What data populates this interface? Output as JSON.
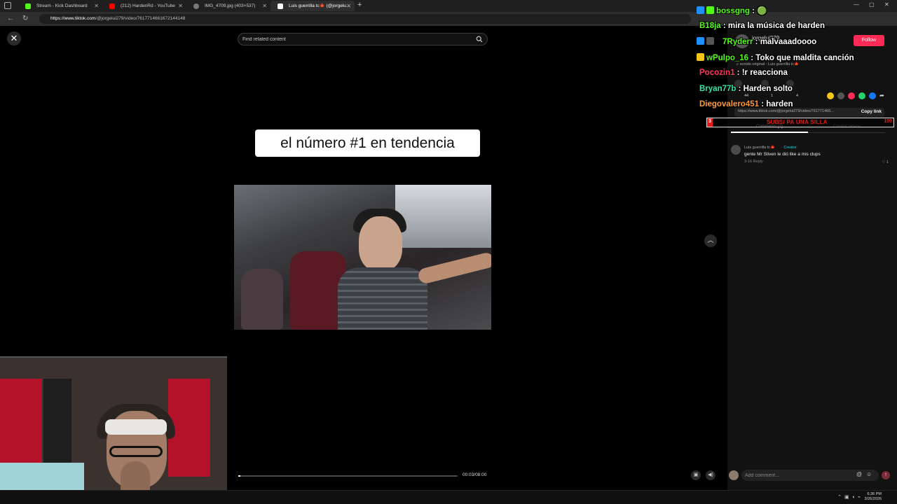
{
  "browser": {
    "tabs": [
      {
        "label": "Stream - Kick Dashboard",
        "color": "#53fc18",
        "active": false
      },
      {
        "label": "(212) HardenRd - YouTube",
        "color": "#ff0000",
        "active": false
      },
      {
        "label": "IMG_4709.jpg (403×537)",
        "color": "#888888",
        "active": false
      },
      {
        "label": "Luis guerrilla tc🍁 (@jorgelu...",
        "color": "#ffffff",
        "active": true
      }
    ],
    "url_host": "https://www.tiktok.com",
    "url_path": "/@jorgelui279/video/7617714661672144148"
  },
  "tiktok": {
    "close_icon": "close-icon",
    "search_placeholder": "Find related content",
    "caption": "el número #1 en tendencia",
    "time": "00:03/08:00",
    "progress": 0.01,
    "username": "jorgelui279",
    "follow_label": "Follow",
    "sound": "♫ sonido original - Luis guerrilla tc🍁",
    "stats": {
      "likes": "44",
      "comments": "1",
      "saves": "4"
    },
    "share_link": "https://www.tiktok.com/@jorgelui279/video/761771466...",
    "copy_link_label": "Copy link",
    "tab_comments": "Comments (1)",
    "tab_creator": "Creator videos",
    "comment": {
      "author": "Luis guerrilla tc🍁",
      "creator_tag": "· Creator",
      "text": "gente Mr Stiven le dió like a mis clups",
      "meta": "3-16    Reply",
      "likes": "♡ 1"
    },
    "comment_placeholder": "Add comment..."
  },
  "goal": {
    "count": "3",
    "label": "SUBS/ PA UNA SILLA",
    "target": "100",
    "progress": 0.03
  },
  "chat": [
    {
      "user": "bossgng",
      "user_color": "#53fc18",
      "msg": " : 🟢",
      "badge": "#1e90ff"
    },
    {
      "user": "B18ja",
      "user_color": "#53fc18",
      "msg": " : mira la música de harden",
      "badge": ""
    },
    {
      "user": "7Ryderr",
      "user_color": "#53fc18",
      "msg": " : malvaaadoooo",
      "badge": "#1e90ff"
    },
    {
      "user": "wPulpo_16",
      "user_color": "#53fc18",
      "msg": " : Toko que maldita canción",
      "badge": "#f5c518"
    },
    {
      "user": "Pocozin1",
      "user_color": "#ff3b5c",
      "msg": " : !r reacciona",
      "badge": ""
    },
    {
      "user": "Bryan77b",
      "user_color": "#2ee6a6",
      "msg": " : Harden solto",
      "badge": ""
    },
    {
      "user": "Diegovalero451",
      "user_color": "#ff9a3c",
      "msg": " : harden",
      "badge": ""
    }
  ],
  "taskbar": {
    "time": "6:36 PM",
    "date": "3/26/2026"
  }
}
